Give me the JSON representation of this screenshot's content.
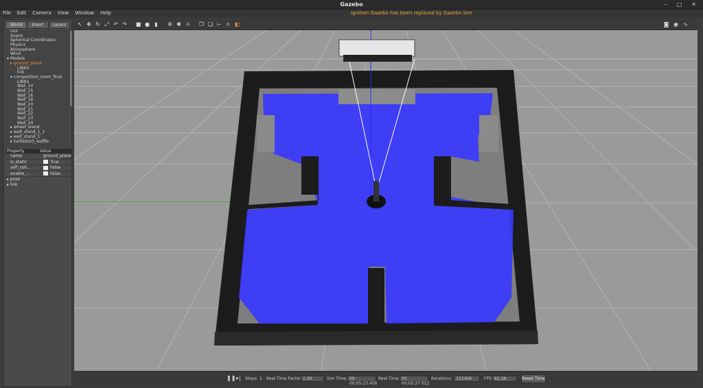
{
  "window": {
    "title": "Gazebo",
    "controls": [
      "–",
      "□",
      "✕"
    ]
  },
  "menu": {
    "items": [
      "File",
      "Edit",
      "Camera",
      "View",
      "Window",
      "Help"
    ],
    "notice": "Ignition Gazebo has been replaced by Gazebo Sim"
  },
  "left_panel": {
    "tabs": [
      "World",
      "Insert",
      "Layers"
    ],
    "tree": [
      {
        "label": "GUI",
        "indent": 1,
        "arrow": ""
      },
      {
        "label": "Scene",
        "indent": 1,
        "arrow": ""
      },
      {
        "label": "Spherical Coordinates",
        "indent": 1,
        "arrow": ""
      },
      {
        "label": "Physics",
        "indent": 1,
        "arrow": ""
      },
      {
        "label": "Atmosphere",
        "indent": 1,
        "arrow": ""
      },
      {
        "label": "Wind",
        "indent": 1,
        "arrow": ""
      },
      {
        "label": "Models",
        "indent": 0,
        "arrow": "▾"
      },
      {
        "label": "ground_plane",
        "indent": 1,
        "arrow": "▸",
        "selected": true
      },
      {
        "label": "LINKS",
        "indent": 3,
        "arrow": ""
      },
      {
        "label": "link",
        "indent": 3,
        "arrow": ""
      },
      {
        "label": "competition_room_final",
        "indent": 1,
        "arrow": "▾"
      },
      {
        "label": "LINKS",
        "indent": 3,
        "arrow": ""
      },
      {
        "label": "Wall_14",
        "indent": 3,
        "arrow": ""
      },
      {
        "label": "Wall_15",
        "indent": 3,
        "arrow": ""
      },
      {
        "label": "Wall_16",
        "indent": 3,
        "arrow": ""
      },
      {
        "label": "Wall_18",
        "indent": 3,
        "arrow": ""
      },
      {
        "label": "Wall_20",
        "indent": 3,
        "arrow": ""
      },
      {
        "label": "Wall_21",
        "indent": 3,
        "arrow": ""
      },
      {
        "label": "Wall_22",
        "indent": 3,
        "arrow": ""
      },
      {
        "label": "Wall_23",
        "indent": 3,
        "arrow": ""
      },
      {
        "label": "Wall_24",
        "indent": 3,
        "arrow": ""
      },
      {
        "label": "wheel_stand",
        "indent": 1,
        "arrow": "▸"
      },
      {
        "label": "wall_stand_1_1",
        "indent": 1,
        "arrow": "▸"
      },
      {
        "label": "wall_stand_1",
        "indent": 1,
        "arrow": "▸"
      },
      {
        "label": "turtlebot3_waffle",
        "indent": 1,
        "arrow": "▸"
      }
    ],
    "props_header": {
      "property": "Property",
      "value": "Value"
    },
    "props": [
      {
        "name": "name",
        "value": "ground_plane",
        "checkbox": false
      },
      {
        "name": "is_static",
        "value": "True",
        "checkbox": true,
        "checked": true
      },
      {
        "name": "self_coll...",
        "value": "False",
        "checkbox": true,
        "checked": false
      },
      {
        "name": "enable_...",
        "value": "False",
        "checkbox": true,
        "checked": false
      }
    ],
    "groups": [
      "pose",
      "link"
    ]
  },
  "toolbar": {
    "icons": [
      "select-icon",
      "translate-icon",
      "rotate-icon",
      "scale-icon",
      "undo-icon",
      "redo-icon",
      "box-icon",
      "sphere-icon",
      "cylinder-icon",
      "point-light-icon",
      "spot-light-icon",
      "directional-light-icon",
      "copy-icon",
      "paste-icon",
      "align-icon",
      "snap-icon",
      "change-view-icon"
    ],
    "right_icons": [
      "screenshot-icon",
      "record-icon",
      "plot-icon"
    ]
  },
  "bottom": {
    "steps_label": "Steps:",
    "steps_value": "1",
    "rtf_label": "Real Time Factor:",
    "rtf_value": "1.00",
    "sim_label": "Sim Time:",
    "sim_value": "00 00:05:23.456",
    "real_label": "Real Time:",
    "real_value": "00 00:05:27.012",
    "iter_label": "Iterations:",
    "iter_value": "323456",
    "fps_label": "FPS:",
    "fps_value": "62.38",
    "reset_label": "Reset Time"
  },
  "colors": {
    "ground": "#9a9a9a",
    "grid": "#b0b0b0",
    "wall": "#1c1c1c",
    "laser": "#2a2aff",
    "selected": "#f08a3c"
  }
}
